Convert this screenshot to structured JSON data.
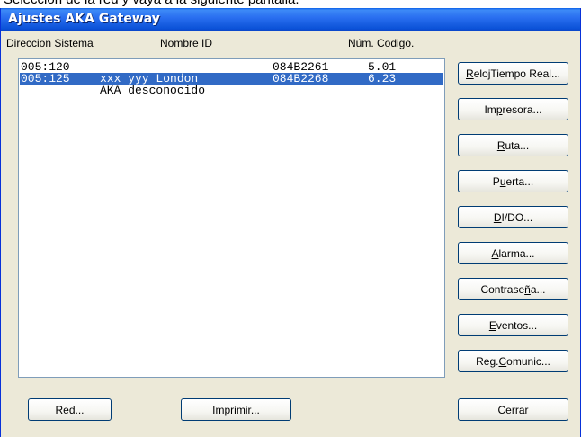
{
  "caption": "Selección de la red y vaya a la siguiente pantalla.",
  "window": {
    "title": "Ajustes AKA Gateway"
  },
  "columns": {
    "system_address": "Direccion Sistema",
    "name_id": "Nombre ID",
    "code_number": "Núm. Codigo."
  },
  "rows": [
    {
      "address": "005:120",
      "name": "",
      "code": "084B2261",
      "version": "5.01",
      "selected": false
    },
    {
      "address": "005:125",
      "name": "xxx yyy London",
      "code": "084B2268",
      "version": "6.23",
      "selected": true
    },
    {
      "address": "",
      "name": "AKA desconocido",
      "code": "",
      "version": "",
      "selected": false
    }
  ],
  "buttons": {
    "clock": {
      "accel": "R",
      "rest": "elojTiempo Real..."
    },
    "printer": {
      "pre": "Im",
      "accel": "p",
      "rest": "resora..."
    },
    "route": {
      "accel": "R",
      "rest": "uta..."
    },
    "door": {
      "pre": "P",
      "accel": "u",
      "rest": "erta..."
    },
    "dido": {
      "accel": "D",
      "rest": "I/DO..."
    },
    "alarm": {
      "accel": "A",
      "rest": "larma..."
    },
    "password": {
      "pre": "Contrase",
      "accel": "ñ",
      "rest": "a..."
    },
    "events": {
      "accel": "E",
      "rest": "ventos..."
    },
    "commlog": {
      "pre": "Reg.",
      "accel": "C",
      "rest": "omunic..."
    },
    "network": {
      "accel": "R",
      "rest": "ed..."
    },
    "print": {
      "accel": "I",
      "rest": "mprimir..."
    },
    "close": {
      "label": "Cerrar"
    }
  }
}
